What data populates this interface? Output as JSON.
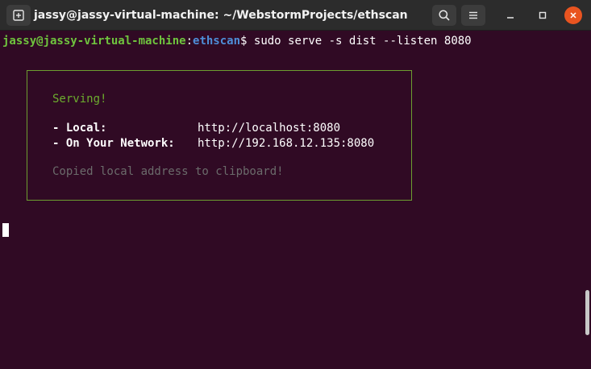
{
  "window": {
    "title": "jassy@jassy-virtual-machine: ~/WebstormProjects/ethscan"
  },
  "terminal": {
    "prompt_user": "jassy@jassy-virtual-machine",
    "prompt_sep": ":",
    "prompt_path": "ethscan",
    "prompt_suffix": "$ ",
    "command": "sudo serve -s dist --listen 8080",
    "box": {
      "serving": "Serving!",
      "local_label": "- Local:",
      "local_url": "http://localhost:8080",
      "network_label": "- On Your Network:",
      "network_url": "http://192.168.12.135:8080",
      "copied_msg": "Copied local address to clipboard!"
    }
  },
  "colors": {
    "background": "#300a24",
    "titlebar": "#2c2c2c",
    "prompt_user": "#6fc43e",
    "prompt_path": "#4e8ed8",
    "box_border": "#6d9e30",
    "serving_text": "#6cad2e",
    "muted_text": "#6b6b6b",
    "close_button": "#e95420"
  }
}
